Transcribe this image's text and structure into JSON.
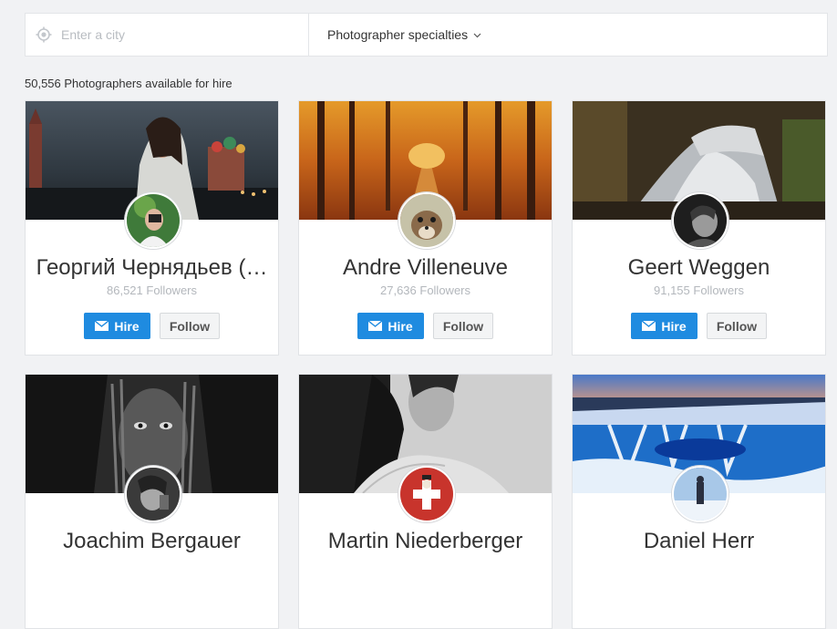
{
  "search": {
    "city_placeholder": "Enter a city",
    "specialties_label": "Photographer specialties"
  },
  "results": {
    "count_text": "50,556 Photographers available for hire"
  },
  "buttons": {
    "hire": "Hire",
    "follow": "Follow"
  },
  "colors": {
    "accent": "#1f8be0",
    "background": "#f1f2f4"
  },
  "photographers": [
    {
      "name": "Георгий Чернядьев (…",
      "followers": "86,521 Followers",
      "cover": "city-portrait-cover",
      "avatar": "photographer-with-camera"
    },
    {
      "name": "Andre Villeneuve",
      "followers": "27,636 Followers",
      "cover": "autumn-forest-cover",
      "avatar": "squirrel"
    },
    {
      "name": "Geert Weggen",
      "followers": "91,155 Followers",
      "cover": "waterfall-cover",
      "avatar": "bw-portrait"
    },
    {
      "name": "Joachim Bergauer",
      "followers": "",
      "cover": "bw-braids-portrait-cover",
      "avatar": "bw-woman"
    },
    {
      "name": "Martin Niederberger",
      "followers": "",
      "cover": "bw-woman-sweater-cover",
      "avatar": "swiss-flag-figure"
    },
    {
      "name": "Daniel Herr",
      "followers": "",
      "cover": "ice-waterfall-cover",
      "avatar": "person-in-snow"
    }
  ]
}
